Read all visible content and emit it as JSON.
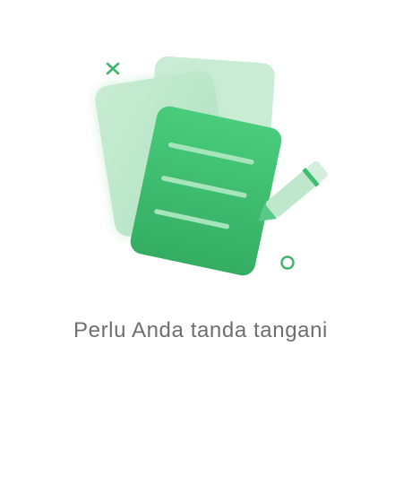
{
  "empty_state": {
    "message": "Perlu Anda tanda tangani",
    "icon": "document-sign-icon"
  },
  "colors": {
    "primary_green": "#3cbd70",
    "light_green": "#c8ebd4",
    "sparkle_green": "#41b36a",
    "text_gray": "#6f6f6f"
  }
}
